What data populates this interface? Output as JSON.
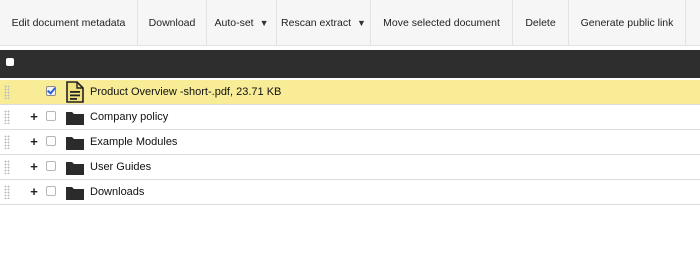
{
  "toolbar": {
    "edit_metadata": "Edit document metadata",
    "download": "Download",
    "autoset": "Auto-set",
    "rescan": "Rescan extract",
    "move": "Move selected document",
    "delete": "Delete",
    "generate_link": "Generate public link"
  },
  "rows": [
    {
      "label": "Product Overview -short-.pdf, 23.71 KB",
      "type": "document",
      "checked": true,
      "expandable": false
    },
    {
      "label": "Company policy",
      "type": "folder",
      "checked": false,
      "expandable": true,
      "expander": "+"
    },
    {
      "label": "Example Modules",
      "type": "folder",
      "checked": false,
      "expandable": true,
      "expander": "+"
    },
    {
      "label": "User Guides",
      "type": "folder",
      "checked": false,
      "expandable": true,
      "expander": "+"
    },
    {
      "label": "Downloads",
      "type": "folder",
      "checked": false,
      "expandable": true,
      "expander": "+"
    }
  ],
  "colors": {
    "selected_row": "#f8ec97",
    "header_bar": "#2e2e2e",
    "toolbar_bg": "#f6f6f6"
  },
  "icons": {
    "document": "document-icon",
    "folder": "folder-icon",
    "dropdown": "caret-down-icon",
    "drag": "drag-handle-icon"
  }
}
